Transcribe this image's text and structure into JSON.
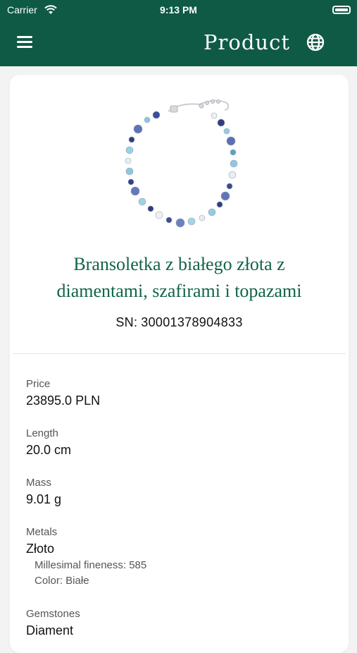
{
  "status_bar": {
    "carrier": "Carrier",
    "time": "9:13 PM"
  },
  "header": {
    "title": "Product"
  },
  "product": {
    "name_line1": "Bransoletka z białego złota z",
    "name_line2": "diamentami, szafirami i topazami",
    "sn_label": "SN:",
    "sn": "30001378904833"
  },
  "details": {
    "price": {
      "label": "Price",
      "value": "23895.0 PLN"
    },
    "length": {
      "label": "Length",
      "value": "20.0 cm"
    },
    "mass": {
      "label": "Mass",
      "value": "9.01 g"
    },
    "metals": {
      "label": "Metals",
      "value": "Złoto",
      "fineness": "Millesimal fineness: 585",
      "color": "Color: Białe"
    },
    "gemstones": {
      "label": "Gemstones",
      "value": "Diament"
    }
  },
  "colors": {
    "header_bg": "#0f5a45",
    "title_green": "#12634b"
  }
}
